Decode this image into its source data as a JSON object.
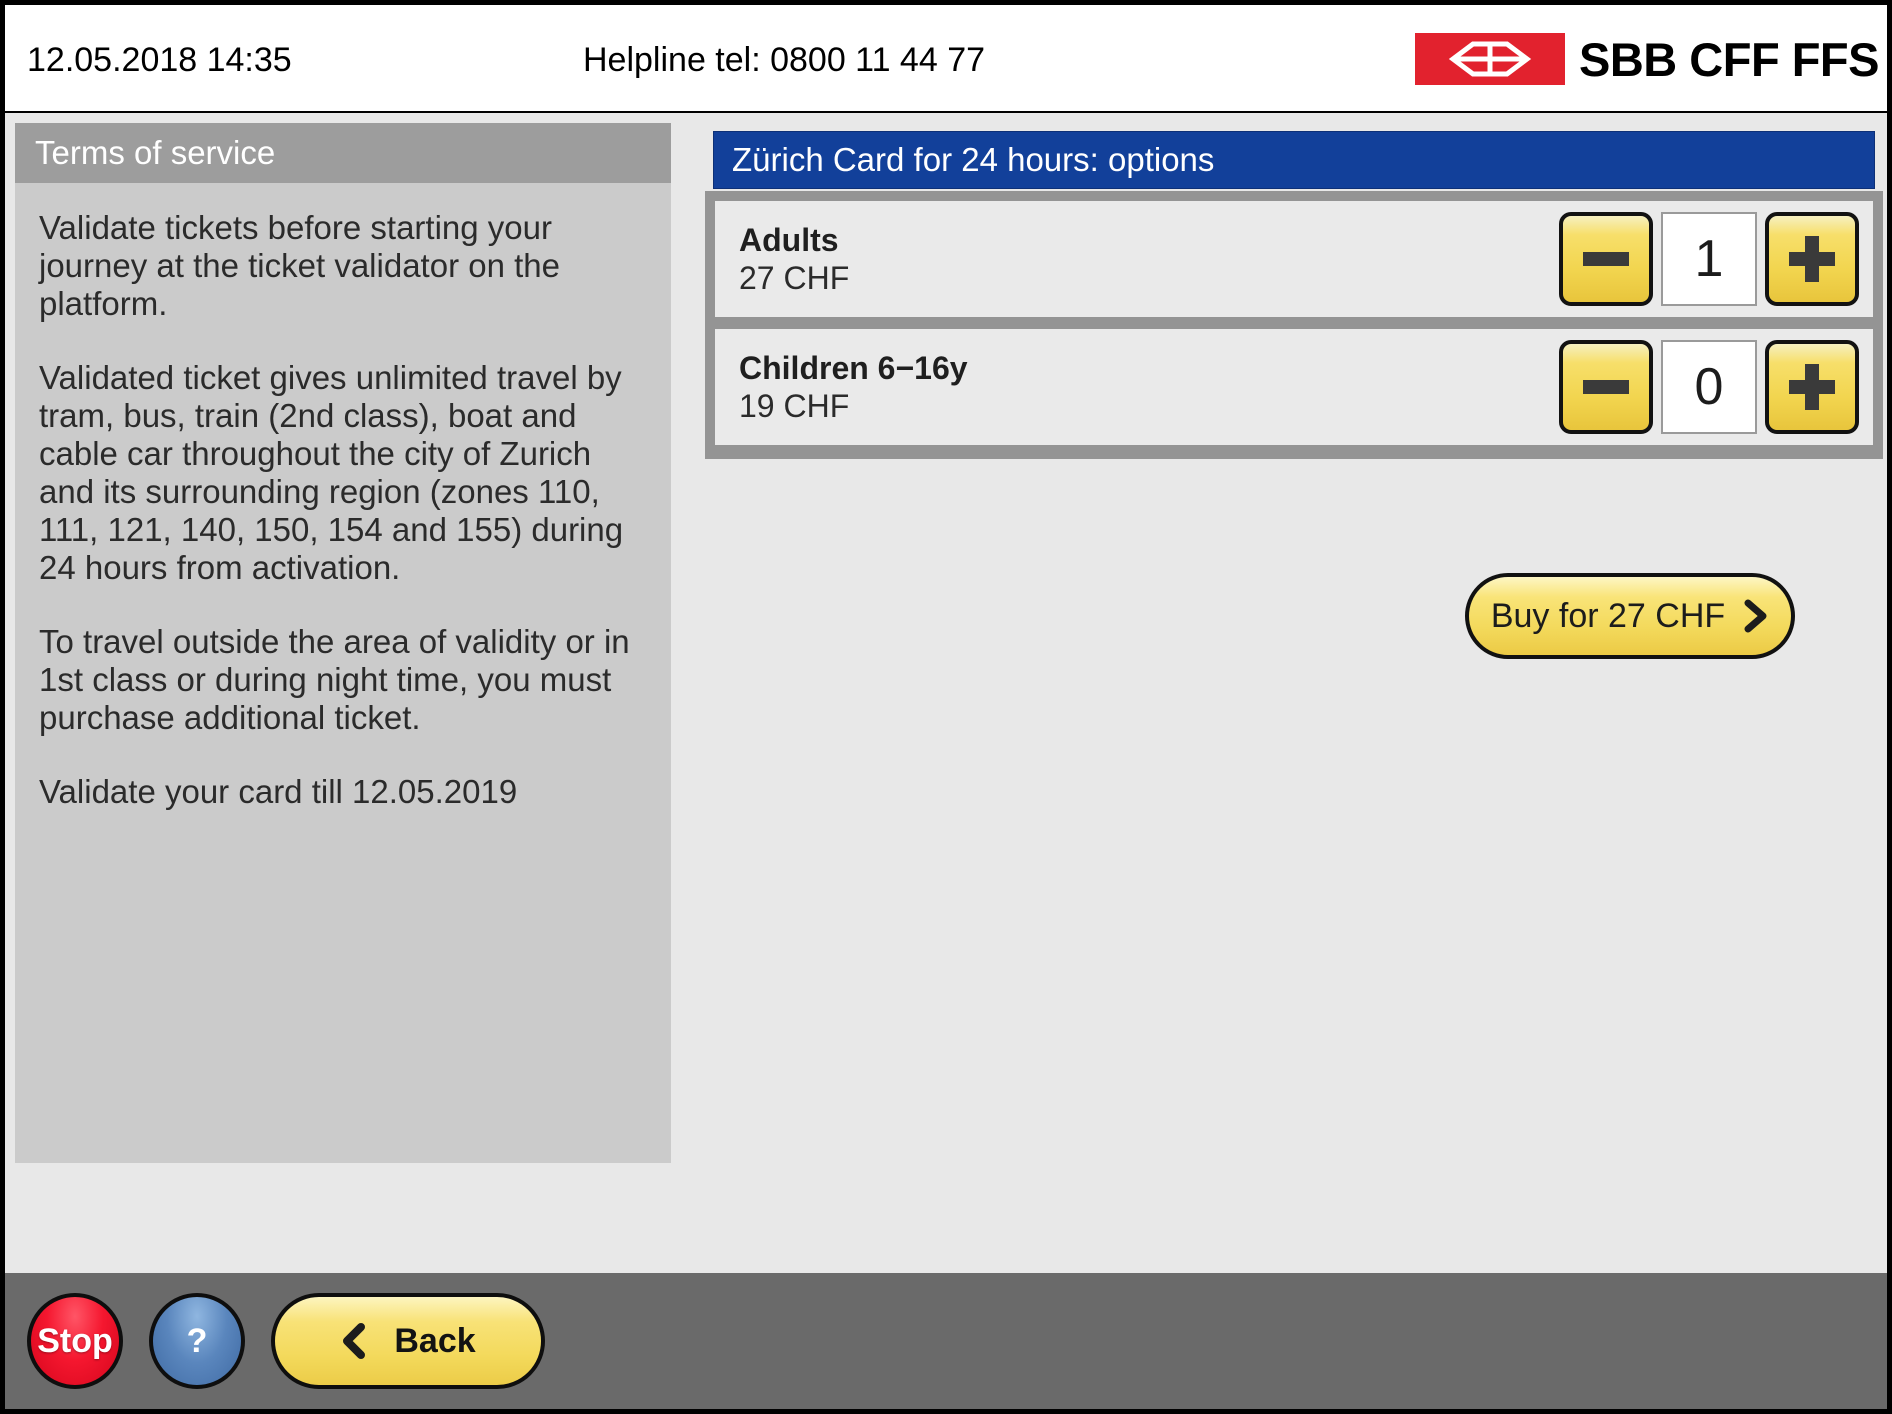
{
  "header": {
    "datetime": "12.05.2018 14:35",
    "helpline": "Helpline tel: 0800 11 44 77",
    "brand_text": "SBB CFF FFS",
    "brand_color": "#e2222e"
  },
  "terms": {
    "title": "Terms of service",
    "paragraphs": [
      "Validate tickets before starting your journey at the ticket validator on the platform.",
      "Validated ticket gives unlimited travel by tram, bus, train (2nd class), boat and cable car throughout the city of Zurich and its surrounding region (zones 110, 111, 121, 140, 150, 154 and 155) during 24 hours from activation.",
      "To travel outside the area of validity or in 1st class or during night time, you must purchase additional ticket.",
      "Validate your card till 12.05.2019"
    ]
  },
  "options": {
    "title": "Zürich Card for 24 hours: options",
    "header_color": "#12409a",
    "rows": [
      {
        "name": "Adults",
        "price": "27 CHF",
        "value": "1",
        "decrement_label": "−",
        "increment_label": "+"
      },
      {
        "name": "Children 6−16y",
        "price": "19 CHF",
        "value": "0",
        "decrement_label": "−",
        "increment_label": "+"
      }
    ]
  },
  "buy": {
    "label": "Buy for 27 CHF"
  },
  "toolbar": {
    "stop_label": "Stop",
    "help_label": "?",
    "back_label": "Back"
  }
}
